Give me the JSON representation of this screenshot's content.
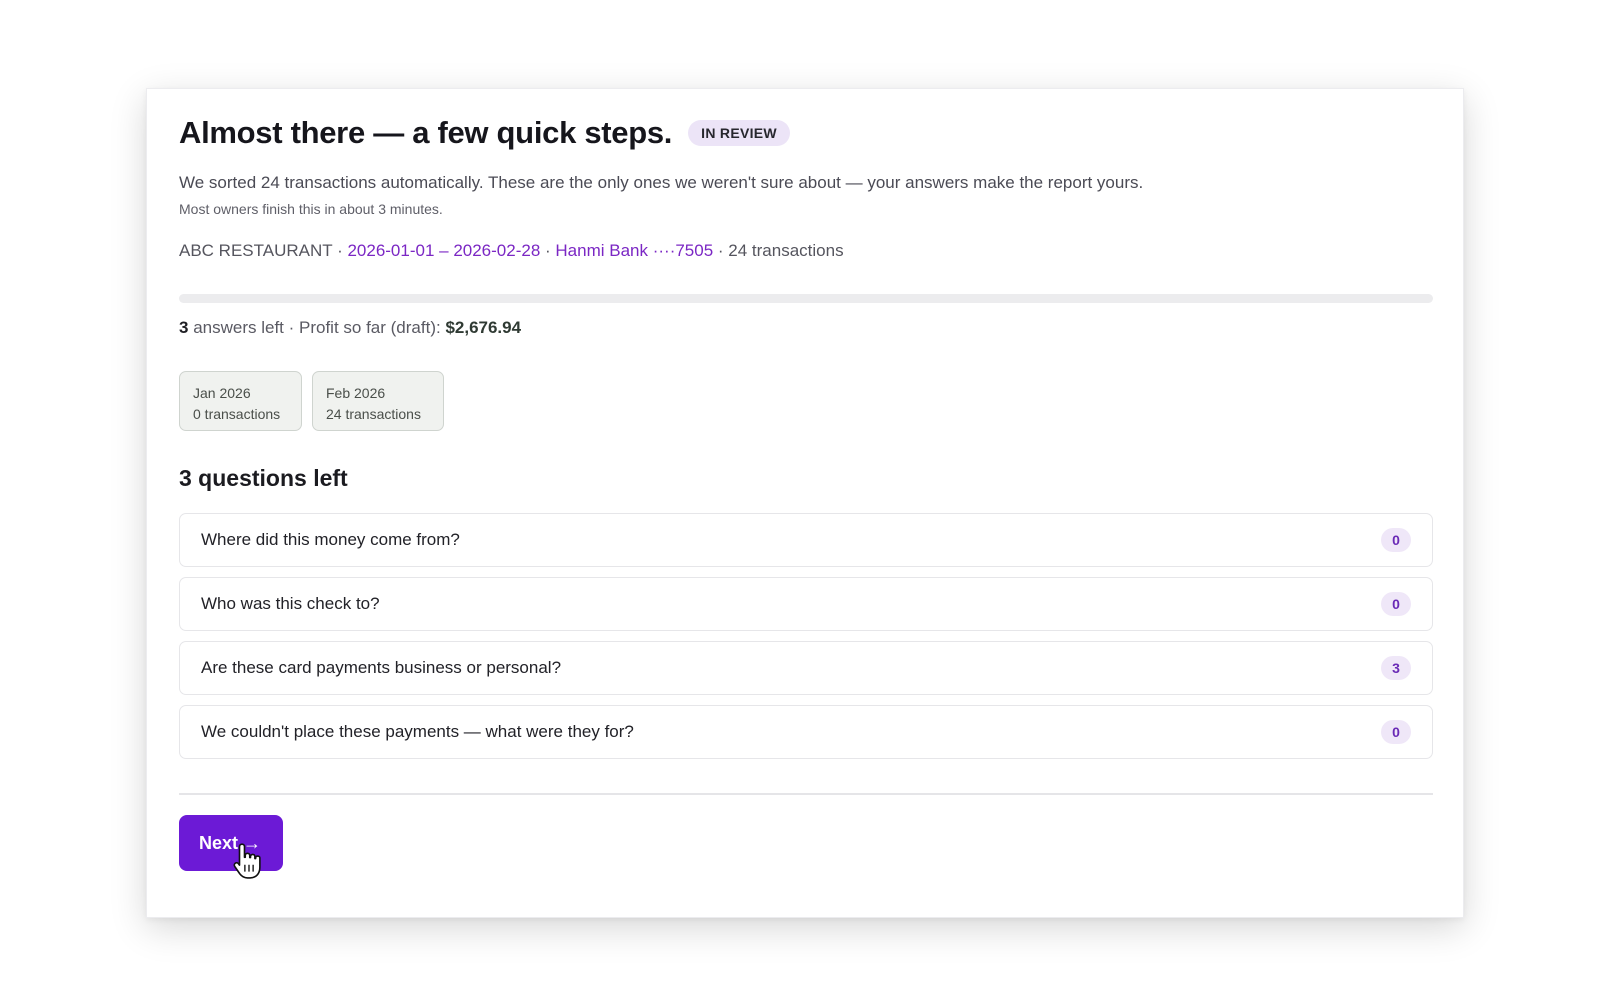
{
  "header": {
    "title": "Almost there — a few quick steps.",
    "badge": "IN REVIEW",
    "subtitle": "We sorted 24 transactions automatically. These are the only ones we weren't sure about — your answers make the report yours.",
    "hint": "Most owners finish this in about 3 minutes."
  },
  "meta": {
    "business": "ABC RESTAURANT",
    "separator": " · ",
    "date_range": "2026-01-01 – 2026-02-28",
    "bank": "Hanmi Bank ····7505",
    "transactions": "24 transactions"
  },
  "progress": {
    "fraction": 0.0
  },
  "status": {
    "count": "3",
    "answers_left": " answers left · Profit so far (draft): ",
    "profit": "$2,676.94"
  },
  "months": [
    {
      "label": "Jan 2026",
      "count": "0 transactions"
    },
    {
      "label": "Feb 2026",
      "count": "24 transactions"
    }
  ],
  "questions": {
    "heading": "3 questions left",
    "items": [
      {
        "text": "Where did this money come from?",
        "count": "0"
      },
      {
        "text": "Who was this check to?",
        "count": "0"
      },
      {
        "text": "Are these card payments business or personal?",
        "count": "3"
      },
      {
        "text": "We couldn't place these payments — what were they for?",
        "count": "0"
      }
    ]
  },
  "actions": {
    "next_label": "Next",
    "next_arrow": "→"
  },
  "colors": {
    "accent": "#6c1ad6",
    "link": "#7b27c4",
    "badge_bg": "#ece4f7"
  }
}
